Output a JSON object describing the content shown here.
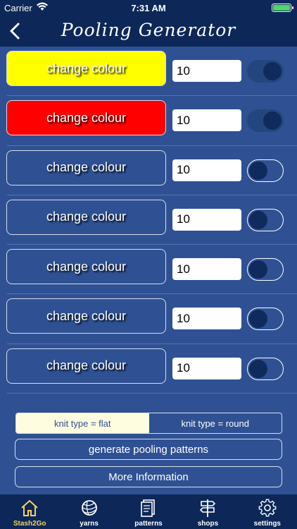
{
  "status": {
    "carrier": "Carrier",
    "time": "7:31 AM"
  },
  "nav": {
    "title": "Pooling Generator"
  },
  "rows": [
    {
      "label": "change colour",
      "value": "10",
      "color": "#ffff00",
      "toggle_on": true
    },
    {
      "label": "change colour",
      "value": "10",
      "color": "#ff0000",
      "toggle_on": true
    },
    {
      "label": "change colour",
      "value": "10",
      "color": "",
      "toggle_on": false
    },
    {
      "label": "change colour",
      "value": "10",
      "color": "",
      "toggle_on": false
    },
    {
      "label": "change colour",
      "value": "10",
      "color": "",
      "toggle_on": false
    },
    {
      "label": "change colour",
      "value": "10",
      "color": "",
      "toggle_on": false
    },
    {
      "label": "change colour",
      "value": "10",
      "color": "",
      "toggle_on": false
    }
  ],
  "knit_type": {
    "flat": "knit type = flat",
    "round": "knit type = round",
    "selected": "flat"
  },
  "buttons": {
    "generate": "generate pooling patterns",
    "more_info": "More Information"
  },
  "tabs": [
    {
      "label": "Stash2Go",
      "icon": "home-icon",
      "active": true
    },
    {
      "label": "yarns",
      "icon": "yarn-ball-icon",
      "active": false
    },
    {
      "label": "patterns",
      "icon": "patterns-icon",
      "active": false
    },
    {
      "label": "shops",
      "icon": "signpost-icon",
      "active": false
    },
    {
      "label": "settings",
      "icon": "gear-icon",
      "active": false
    }
  ],
  "colors": {
    "background": "#2f5193",
    "bar": "#0d2758",
    "active_tab": "#f2d35a"
  }
}
